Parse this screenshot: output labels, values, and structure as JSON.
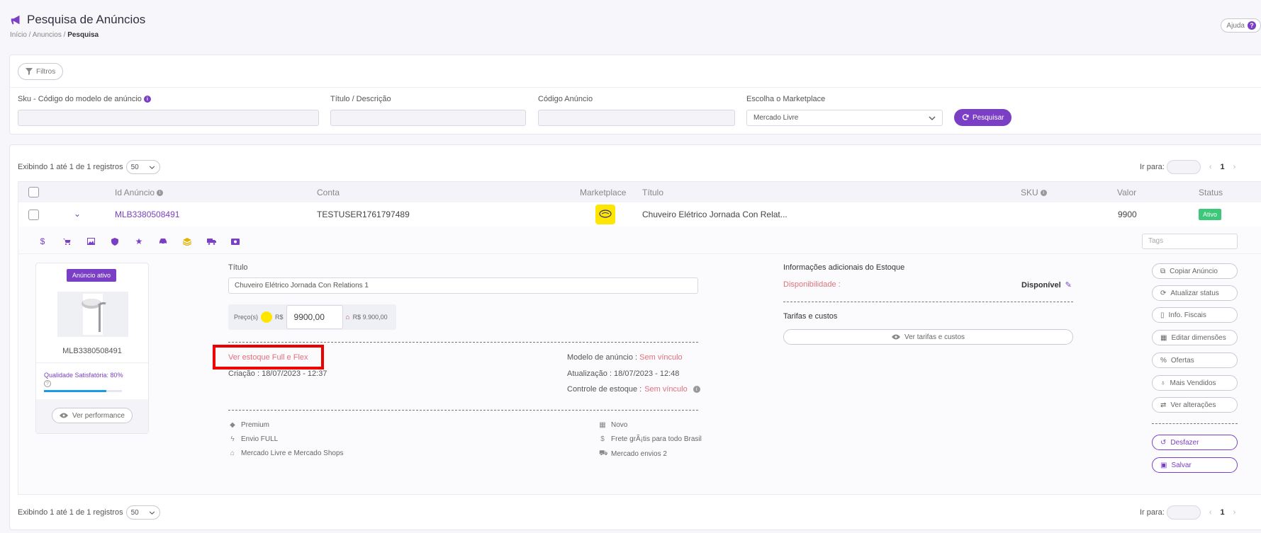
{
  "header": {
    "title": "Pesquisa de Anúncios",
    "breadcrumb": [
      "Início",
      "Anuncios",
      "Pesquisa"
    ],
    "help_label": "Ajuda"
  },
  "filters": {
    "toggle_label": "Filtros",
    "sku_label": "Sku - Código do modelo de anúncio",
    "title_label": "Título / Descrição",
    "code_label": "Código Anúncio",
    "marketplace_label": "Escolha o Marketplace",
    "marketplace_value": "Mercado Livre",
    "search_label": "Pesquisar"
  },
  "list": {
    "showing_text": "Exibindo 1 até 1 de 1 registros",
    "page_size": "50",
    "goto_label": "Ir para:",
    "current_page": "1",
    "columns": [
      "Id Anúncio",
      "Conta",
      "Marketplace",
      "Título",
      "SKU",
      "Valor",
      "Status"
    ],
    "row": {
      "id": "MLB3380508491",
      "account": "TESTUSER1761797489",
      "title": "Chuveiro Elétrico Jornada Con Relat...",
      "value": "9900",
      "status": "Ativo"
    }
  },
  "detail": {
    "tags_placeholder": "Tags",
    "active_badge": "Anúncio ativo",
    "ad_id": "MLB3380508491",
    "quality": "Qualidade Satisfatória: 80%",
    "quality_fraction": 0.8,
    "performance_label": "Ver performance",
    "title_label": "Título",
    "title_value": "Chuveiro Elétrico Jornada Con Relations 1",
    "price_label": "Preço(s)",
    "currency": "R$",
    "price_value": "9900,00",
    "price_total": "R$ 9.900,00",
    "stock_link": "Ver estoque Full e Flex",
    "created": "Criação : 18/07/2023 - 12:37",
    "model_label": "Modelo de anúncio :",
    "model_value": "Sem vínculo",
    "updated": "Atualização : 18/07/2023 - 12:48",
    "stock_control_label": "Controle de estoque :",
    "stock_control_value": "Sem vínculo",
    "features_left": [
      "Premium",
      "Envio FULL",
      "Mercado Livre e Mercado Shops"
    ],
    "features_right": [
      "Novo",
      "Frete grÃ¡tis para todo Brasil",
      "Mercado envios 2"
    ],
    "stock_info_title": "Informações adicionais do Estoque",
    "availability_label": "Disponibilidade :",
    "availability_value": "Disponível",
    "fees_title": "Tarifas e custos",
    "fees_button": "Ver tarifas e custos",
    "actions": [
      "Copiar Anúncio",
      "Atualizar status",
      "Info. Fiscais",
      "Editar dimensões",
      "Ofertas",
      "Mais Vendidos",
      "Ver alterações"
    ],
    "undo_label": "Desfazer",
    "save_label": "Salvar"
  },
  "colors": {
    "accent": "#7a3fc4",
    "status_green": "#3cc878",
    "link_red": "#e0707a",
    "ml_yellow": "#ffe600",
    "progress_blue": "#1a9be8"
  }
}
